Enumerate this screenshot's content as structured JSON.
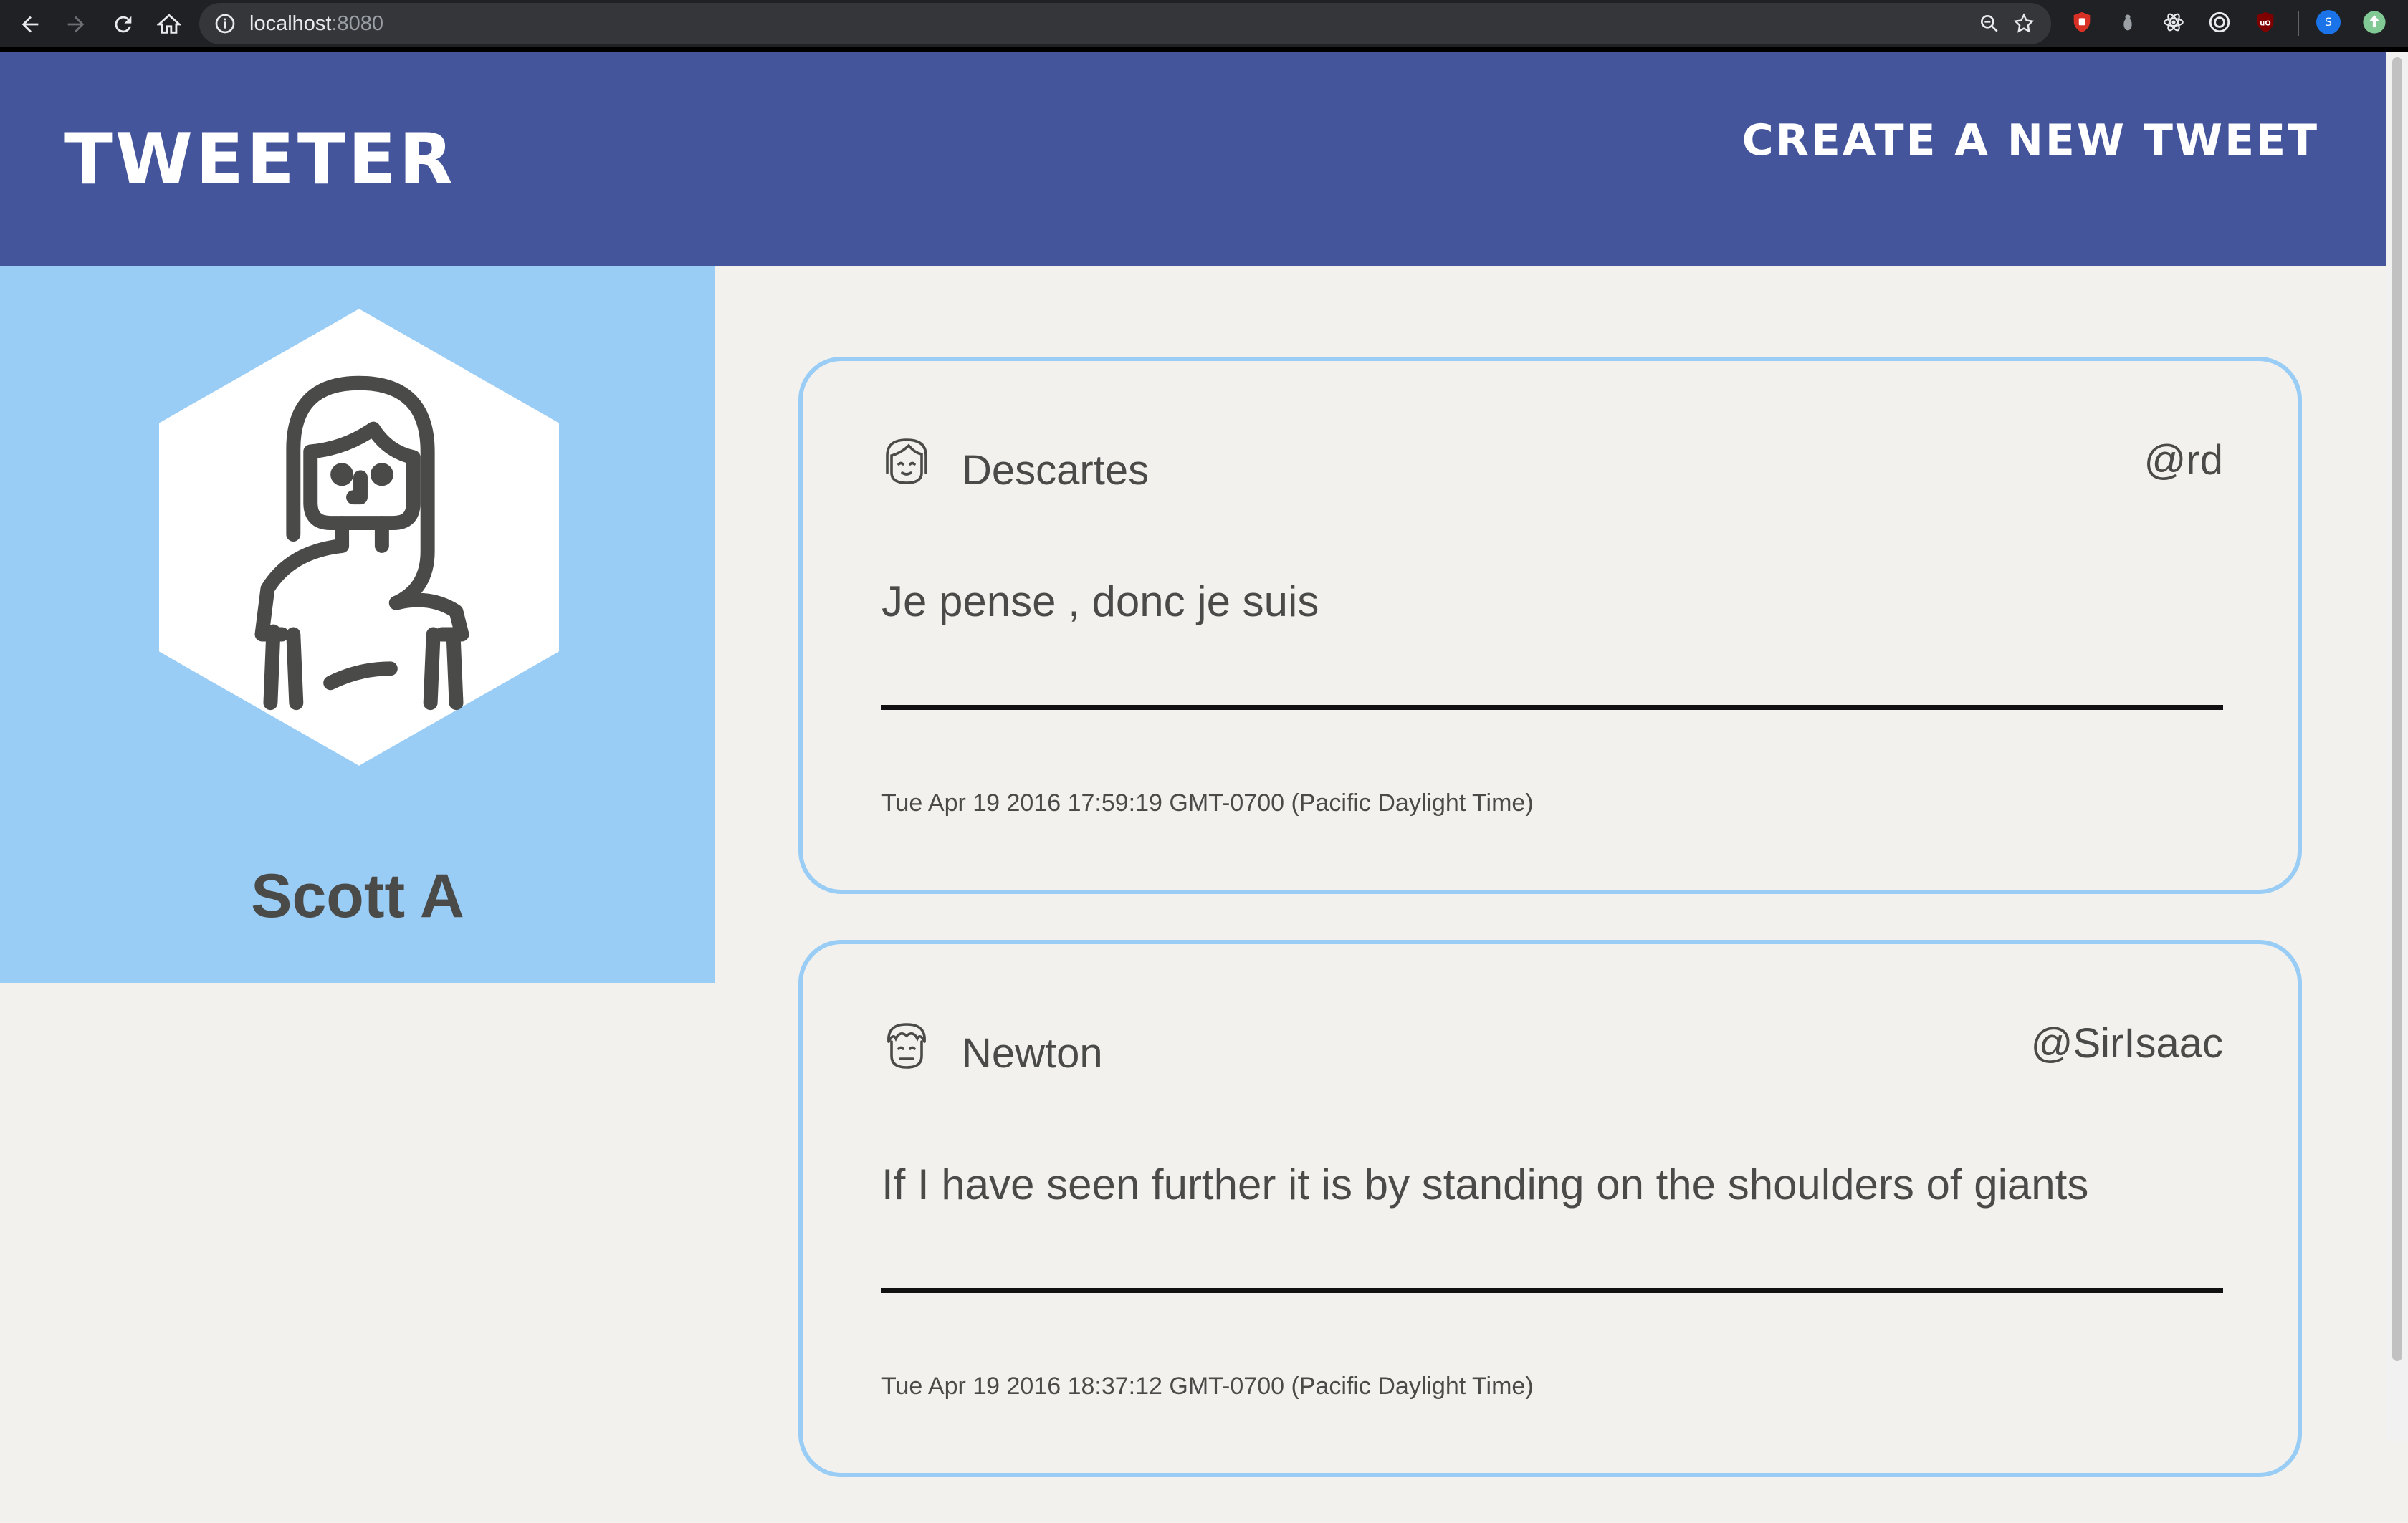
{
  "browser": {
    "url_host": "localhost",
    "url_port": ":8080",
    "profile_initial": "S"
  },
  "header": {
    "brand": "TWEETER",
    "new_tweet_label": "CREATE A NEW TWEET"
  },
  "profile": {
    "name": "Scott A"
  },
  "tweets": [
    {
      "name": "Descartes",
      "handle": "@rd",
      "text": "Je pense , donc je suis",
      "date": "Tue Apr 19 2016 17:59:19 GMT-0700 (Pacific Daylight Time)"
    },
    {
      "name": "Newton",
      "handle": "@SirIsaac",
      "text": "If I have seen further it is by standing on the shoulders of giants",
      "date": "Tue Apr 19 2016 18:37:12 GMT-0700 (Pacific Daylight Time)"
    }
  ],
  "colors": {
    "header_bg": "#44559c",
    "profile_bg": "#9acdf5",
    "page_bg": "#f2f1ee",
    "text": "#4a4a48"
  }
}
